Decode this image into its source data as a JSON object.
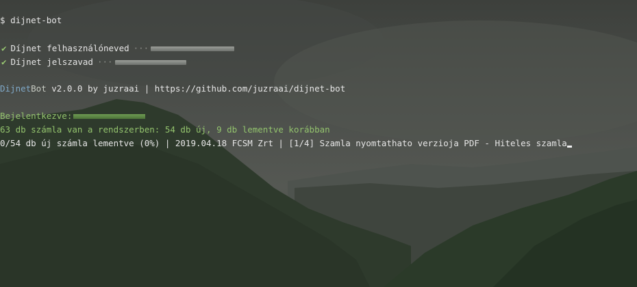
{
  "terminal": {
    "prompt_symbol": "$",
    "command": "dijnet-bot",
    "username_prompt": "Díjnet felhasználóneved",
    "password_prompt": "Díjnet jelszavad",
    "check_glyph": "✔",
    "dots": "···",
    "banner": {
      "app_name_part1": "Dijnet",
      "app_name_part2": "Bot",
      "rest": " v2.0.0 by juzraai | https://github.com/juzraai/dijnet-bot"
    },
    "login_label": "Bejelentkezve:",
    "status_line": "63 db számla van a rendszerben: 54 db új, 9 db lementve korábban",
    "progress_line": "0/54 db új számla lementve (0%) | 2019.04.18 FCSM Zrt | [1/4] Szamla nyomtathato verzioja PDF - Hiteles szamla"
  }
}
